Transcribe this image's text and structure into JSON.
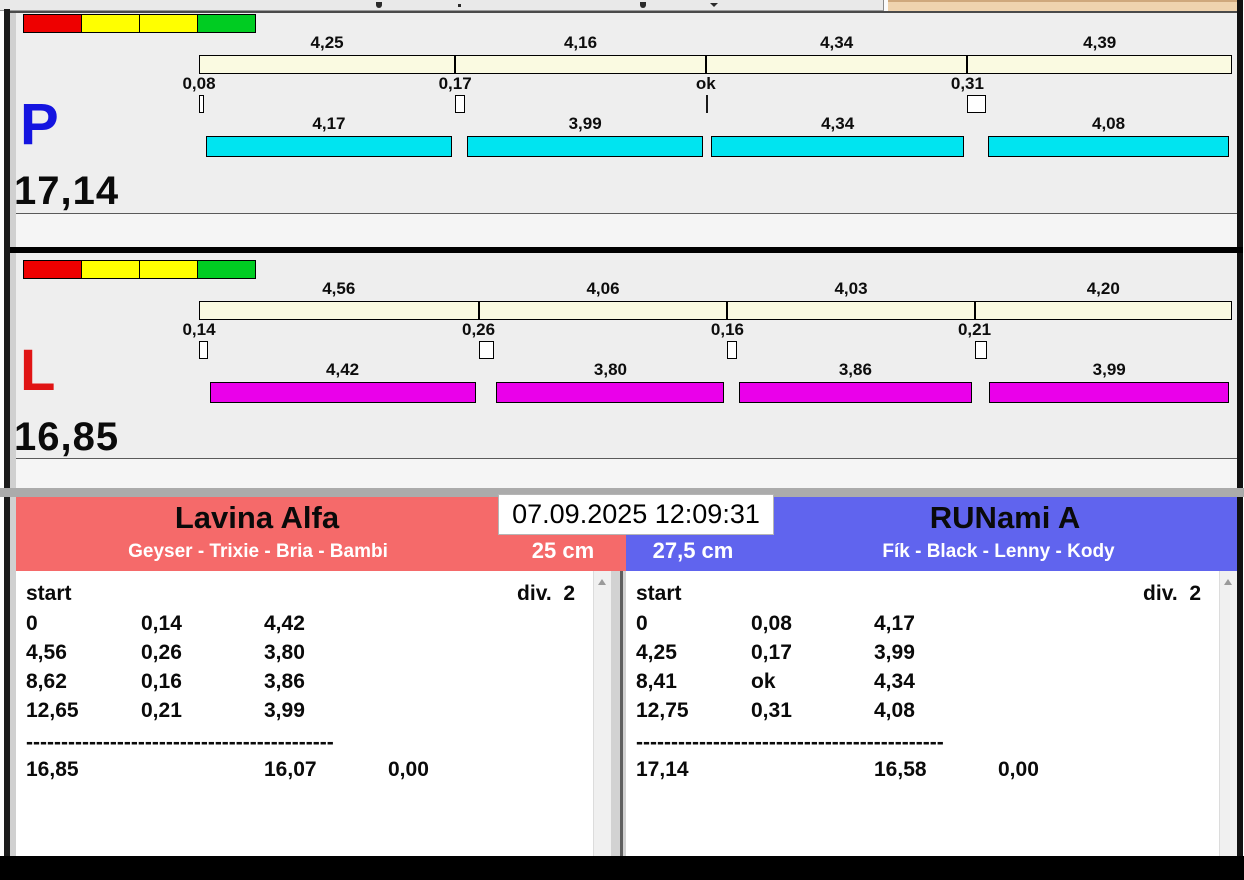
{
  "clock": "07.09.2025 12:09:31",
  "colors": {
    "cream_bar": "#fafae1",
    "cyan_bar": "#00e4f0",
    "magenta_bar": "#ea00ea",
    "left_header": "#f56a6a",
    "right_header": "#6064ee",
    "light_red": "#ee0000",
    "light_yellow": "#ffff00",
    "light_green": "#00cc22",
    "peach_tab": "#efd3ae"
  },
  "lanes": [
    {
      "id": "P",
      "letter": "P",
      "letter_color": "#1414e0",
      "bar_color": "#00e4f0",
      "total": "17,14",
      "lights": [
        "#ee0000",
        "#ffff00",
        "#ffff00",
        "#00cc22"
      ],
      "splits": [
        "4,25",
        "4,16",
        "4,34",
        "4,39"
      ],
      "changes": [
        "0,08",
        "0,17",
        "ok",
        "0,31"
      ],
      "dogs": [
        "4,17",
        "3,99",
        "4,34",
        "4,08"
      ]
    },
    {
      "id": "L",
      "letter": "L",
      "letter_color": "#e01414",
      "bar_color": "#ea00ea",
      "total": "16,85",
      "lights": [
        "#ee0000",
        "#ffff00",
        "#ffff00",
        "#00cc22"
      ],
      "splits": [
        "4,56",
        "4,06",
        "4,03",
        "4,20"
      ],
      "changes": [
        "0,14",
        "0,26",
        "0,16",
        "0,21"
      ],
      "dogs": [
        "4,42",
        "3,80",
        "3,86",
        "3,99"
      ]
    }
  ],
  "teams": [
    {
      "name": "Lavina Alfa",
      "dogs_line": "Geyser - Trixie - Bria - Bambi",
      "jump_height": "25 cm",
      "table": {
        "header_left": "start",
        "header_right": "div.  2",
        "rows": [
          [
            "0",
            "0,14",
            "4,42"
          ],
          [
            "4,56",
            "0,26",
            "3,80"
          ],
          [
            "8,62",
            "0,16",
            "3,86"
          ],
          [
            "12,65",
            "0,21",
            "3,99"
          ]
        ],
        "separator": "--------------------------------------------",
        "totals": [
          "16,85",
          "16,07",
          "0,00"
        ]
      }
    },
    {
      "name": "RUNami A",
      "dogs_line": "Fík - Black - Lenny - Kody",
      "jump_height": "27,5 cm",
      "table": {
        "header_left": "start",
        "header_right": "div.  2",
        "rows": [
          [
            "0",
            "0,08",
            "4,17"
          ],
          [
            "4,25",
            "0,17",
            "3,99"
          ],
          [
            "8,41",
            "ok",
            "4,34"
          ],
          [
            "12,75",
            "0,31",
            "4,08"
          ]
        ],
        "separator": "--------------------------------------------",
        "totals": [
          "17,14",
          "16,58",
          "0,00"
        ]
      }
    }
  ]
}
